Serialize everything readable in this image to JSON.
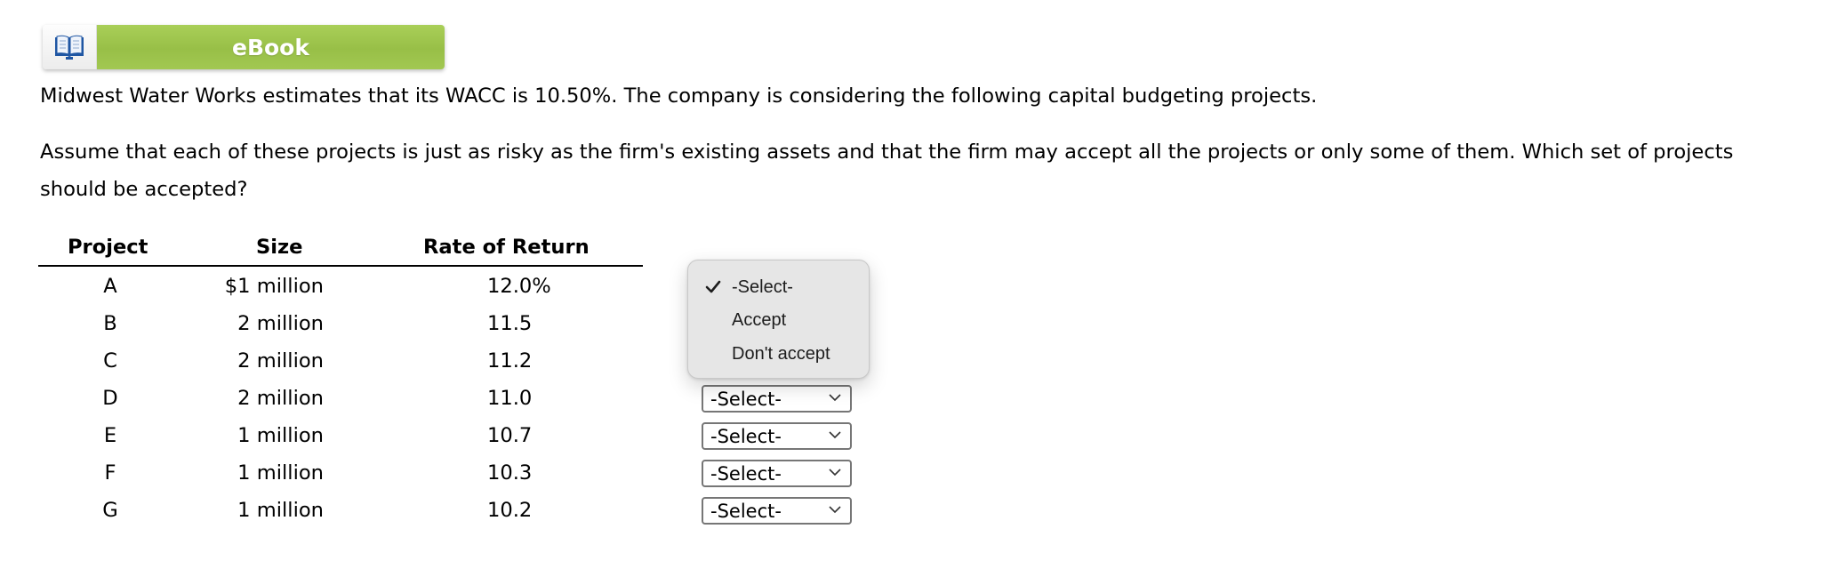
{
  "ebook": {
    "label": "eBook",
    "icon": "open-book-icon",
    "accent_color": "#9dc44a"
  },
  "question": {
    "intro": "Midwest Water Works estimates that its WACC is 10.50%. The company is considering the following capital budgeting projects.",
    "prompt": "Assume that each of these projects is just as risky as the firm's existing assets and that the firm may accept all the projects or only some of them. Which set of projects should be accepted?"
  },
  "table": {
    "headers": [
      "Project",
      "Size",
      "Rate of Return"
    ],
    "rows": [
      {
        "project": "A",
        "size": "$1 million",
        "rate": "12.0%"
      },
      {
        "project": "B",
        "size": "2 million",
        "rate": "11.5"
      },
      {
        "project": "C",
        "size": "2 million",
        "rate": "11.2"
      },
      {
        "project": "D",
        "size": "2 million",
        "rate": "11.0"
      },
      {
        "project": "E",
        "size": "1 million",
        "rate": "10.7"
      },
      {
        "project": "F",
        "size": "1 million",
        "rate": "10.3"
      },
      {
        "project": "G",
        "size": "1 million",
        "rate": "10.2"
      }
    ]
  },
  "selects": [
    {
      "project": "D",
      "value": "-Select-"
    },
    {
      "project": "E",
      "value": "-Select-"
    },
    {
      "project": "F",
      "value": "-Select-"
    },
    {
      "project": "G",
      "value": "-Select-"
    }
  ],
  "dropdown_popup": {
    "options": [
      "-Select-",
      "Accept",
      "Don't accept"
    ],
    "selected_index": 0
  }
}
